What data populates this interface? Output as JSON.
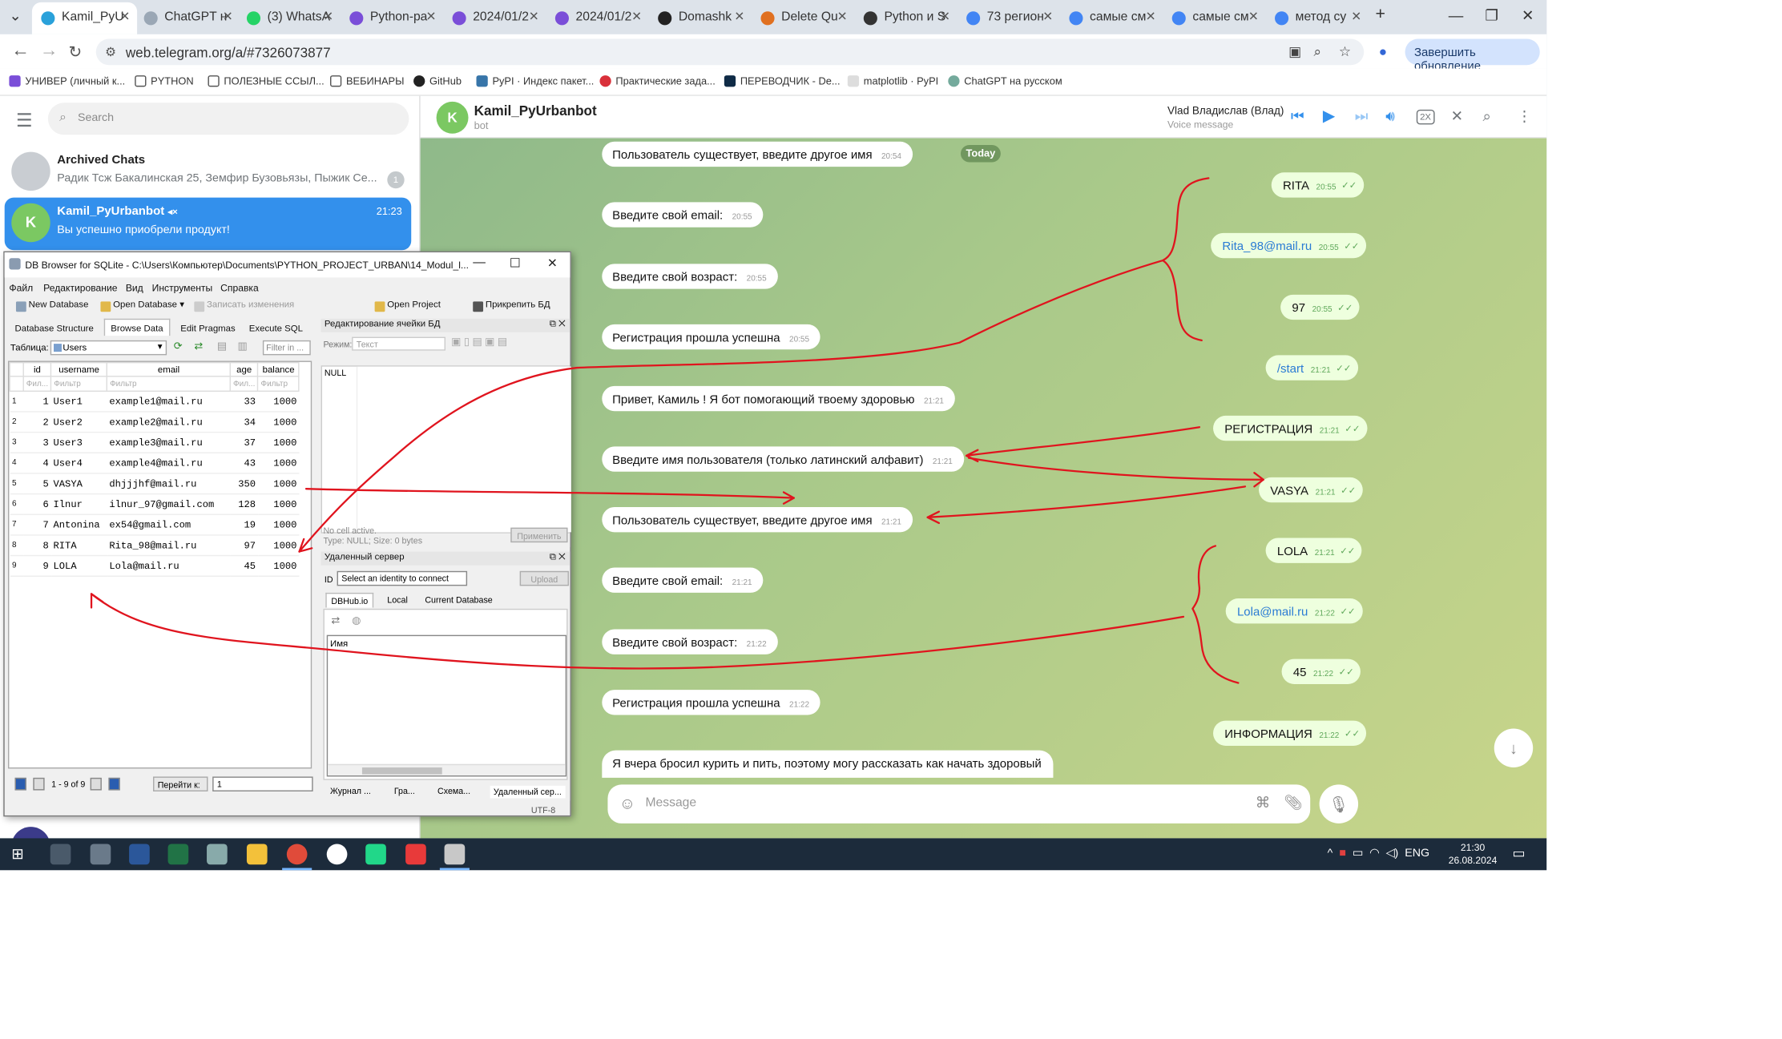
{
  "browser": {
    "tabs": [
      {
        "label": "Kamil_PyU",
        "active": true
      },
      {
        "label": "ChatGPT н"
      },
      {
        "label": "(3) WhatsA"
      },
      {
        "label": "Python-ра"
      },
      {
        "label": "2024/01/2"
      },
      {
        "label": "2024/01/2"
      },
      {
        "label": "Domashk"
      },
      {
        "label": "Delete Qu"
      },
      {
        "label": "Python и S"
      },
      {
        "label": "73 регион"
      },
      {
        "label": "самые см"
      },
      {
        "label": "самые см"
      },
      {
        "label": "метод су"
      }
    ],
    "url": "web.telegram.org/a/#7326073877",
    "update_button": "Завершить обновление",
    "bookmarks": [
      "УНИВЕР (личный к...",
      "PYTHON",
      "ПОЛЕЗНЫЕ ССЫЛ...",
      "ВЕБИНАРЫ",
      "GitHub",
      "PyPI · Индекс пакет...",
      "Практические зада...",
      "ПЕРЕВОДЧИК - De...",
      "matplotlib · PyPI",
      "ChatGPT на русском"
    ]
  },
  "telegram": {
    "search_placeholder": "Search",
    "chats": [
      {
        "name": "Archived Chats",
        "preview": "Радик Тсж Бакалинская 25, Земфир Бузовьязы, Пыжик Се...",
        "badge": "1"
      },
      {
        "name": "Kamil_PyUrbanbot",
        "preview": "Вы успешно приобрели продукт!",
        "time": "21:23",
        "avatar": "K"
      }
    ],
    "header": {
      "avatar": "K",
      "name": "Kamil_PyUrbanbot",
      "status": "bot",
      "voice_author": "Vlad Владислав (Влад)",
      "voice_label": "Voice message",
      "speed": "2X"
    },
    "date_chip": "Today",
    "incoming": [
      {
        "text": "Пользователь существует, введите другое имя",
        "time": "20:54"
      },
      {
        "text": "Введите свой email:",
        "time": "20:55"
      },
      {
        "text": "Введите свой возраст:",
        "time": "20:55"
      },
      {
        "text": "Регистрация прошла успешна",
        "time": "20:55"
      },
      {
        "text": "Привет, Камиль !  Я бот помогающий твоему здоровью",
        "time": "21:21"
      },
      {
        "text": "Введите имя пользователя (только латинский алфавит)",
        "time": "21:21"
      },
      {
        "text": "Пользователь существует, введите другое имя",
        "time": "21:21"
      },
      {
        "text": "Введите свой email:",
        "time": "21:21"
      },
      {
        "text": "Введите свой возраст:",
        "time": "21:22"
      },
      {
        "text": "Регистрация прошла успешна",
        "time": "21:22"
      },
      {
        "text": "Я вчера бросил курить и пить, поэтому могу рассказать как начать здоровый",
        "time": ""
      }
    ],
    "outgoing": [
      {
        "text": "RITA",
        "time": "20:55"
      },
      {
        "text": "Rita_98@mail.ru",
        "time": "20:55",
        "link": true
      },
      {
        "text": "97",
        "time": "20:55"
      },
      {
        "text": "/start",
        "time": "21:21",
        "link": true
      },
      {
        "text": "РЕГИСТРАЦИЯ",
        "time": "21:21"
      },
      {
        "text": "VASYA",
        "time": "21:21"
      },
      {
        "text": "LOLA",
        "time": "21:21"
      },
      {
        "text": "Lola@mail.ru",
        "time": "21:22",
        "link": true
      },
      {
        "text": "45",
        "time": "21:22"
      },
      {
        "text": "ИНФОРМАЦИЯ",
        "time": "21:22"
      }
    ],
    "message_placeholder": "Message"
  },
  "dbbrowser": {
    "title": "DB Browser for SQLite - C:\\Users\\Компьютер\\Documents\\PYTHON_PROJECT_URBAN\\14_Modul_l...",
    "menus": [
      "Файл",
      "Редактирование",
      "Вид",
      "Инструменты",
      "Справка"
    ],
    "toolbar": [
      "New Database",
      "Open Database",
      "Записать изменения",
      "Open Project",
      "Прикрепить БД"
    ],
    "tabs": [
      "Database Structure",
      "Browse Data",
      "Edit Pragmas",
      "Execute SQL"
    ],
    "table_label": "Таблица:",
    "table_name": "Users",
    "filter_placeholder": "Filter in ...",
    "columns": [
      "id",
      "username",
      "email",
      "age",
      "balance"
    ],
    "filter_cells": [
      "Фил...",
      "Фильтр",
      "Фильтр",
      "Фил...",
      "Фильтр"
    ],
    "rows": [
      [
        "1",
        "1",
        "User1",
        "example1@mail.ru",
        "33",
        "1000"
      ],
      [
        "2",
        "2",
        "User2",
        "example2@mail.ru",
        "34",
        "1000"
      ],
      [
        "3",
        "3",
        "User3",
        "example3@mail.ru",
        "37",
        "1000"
      ],
      [
        "4",
        "4",
        "User4",
        "example4@mail.ru",
        "43",
        "1000"
      ],
      [
        "5",
        "5",
        "VASYA",
        "dhjjjhf@mail.ru",
        "350",
        "1000"
      ],
      [
        "6",
        "6",
        "Ilnur",
        "ilnur_97@gmail.com",
        "128",
        "1000"
      ],
      [
        "7",
        "7",
        "Antonina",
        "ex54@gmail.com",
        "19",
        "1000"
      ],
      [
        "8",
        "8",
        "RITA",
        "Rita_98@mail.ru",
        "97",
        "1000"
      ],
      [
        "9",
        "9",
        "LOLA",
        "Lola@mail.ru",
        "45",
        "1000"
      ]
    ],
    "pager_text": "1 - 9 of 9",
    "goto_label": "Перейти к:",
    "goto_value": "1",
    "edit_panel": {
      "title": "Редактирование ячейки БД",
      "mode_label": "Режим:",
      "mode_value": "Текст",
      "null": "NULL",
      "status1": "No cell active.",
      "status2": "Type: NULL; Size: 0 bytes",
      "apply": "Применить"
    },
    "remote_panel": {
      "title": "Удаленный сервер",
      "id_label": "ID",
      "identity": "Select an identity to connect",
      "upload": "Upload",
      "tabs": [
        "DBHub.io",
        "Local",
        "Current Database"
      ],
      "column": "Имя"
    },
    "bottom_tabs": [
      "Журнал ...",
      "Гра...",
      "Схема...",
      "Удаленный сер..."
    ],
    "encoding": "UTF-8"
  },
  "taskbar": {
    "lang": "ENG",
    "time": "21:30",
    "date": "26.08.2024"
  },
  "colors": {
    "telegram_accent": "#3390ec",
    "annotation_red": "#e0141e",
    "outgoing_bubble": "#eeffde"
  }
}
